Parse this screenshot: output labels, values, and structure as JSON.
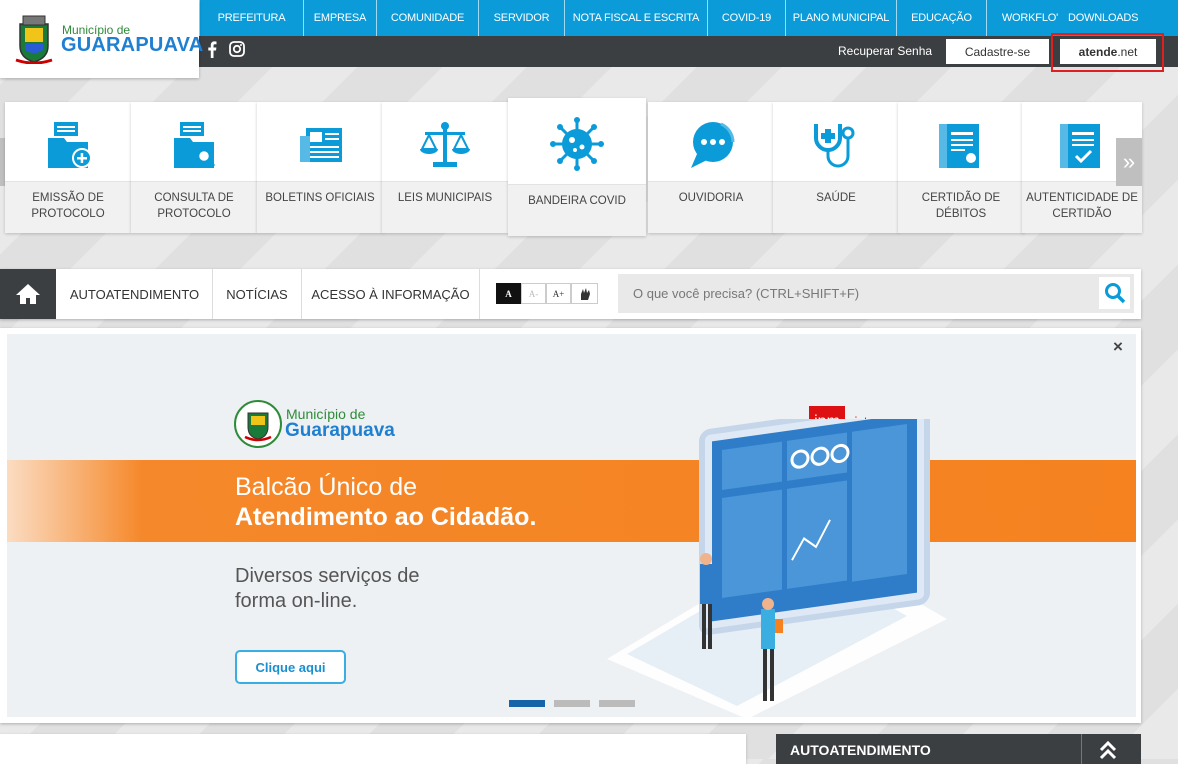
{
  "header": {
    "logo_top": "Município de",
    "logo_bottom": "GUARAPUAVA",
    "top_nav": [
      "PREFEITURA",
      "EMPRESA",
      "COMUNIDADE",
      "SERVIDOR",
      "NOTA FISCAL E ESCRITA",
      "COVID-19",
      "PLANO MUNICIPAL",
      "EDUCAÇÃO",
      "WORKFLO'",
      "DOWNLOADS"
    ],
    "recover_password": "Recuperar Senha",
    "signup": "Cadastre-se",
    "atende_bold": "atende",
    "atende_rest": ".net"
  },
  "services": [
    {
      "label": "EMISSÃO DE PROTOCOLO",
      "icon": "folder-plus-icon"
    },
    {
      "label": "CONSULTA DE PROTOCOLO",
      "icon": "folder-search-icon"
    },
    {
      "label": "BOLETINS OFICIAIS",
      "icon": "newspaper-icon"
    },
    {
      "label": "LEIS MUNICIPAIS",
      "icon": "scales-icon"
    },
    {
      "label": "BANDEIRA COVID",
      "icon": "virus-icon"
    },
    {
      "label": "OUVIDORIA",
      "icon": "chat-bubble-icon"
    },
    {
      "label": "SAÚDE",
      "icon": "stethoscope-icon"
    },
    {
      "label": "CERTIDÃO DE DÉBITOS",
      "icon": "certificate-icon"
    },
    {
      "label": "AUTENTICIDADE DE CERTIDÃO",
      "icon": "certificate-check-icon"
    }
  ],
  "nav": {
    "items": [
      "AUTOATENDIMENTO",
      "NOTÍCIAS",
      "ACESSO À INFORMAÇÃO"
    ],
    "font_buttons": [
      "A",
      "A-",
      "A+"
    ],
    "search_placeholder": "O que você precisa? (CTRL+SHIFT+F)"
  },
  "banner": {
    "logo_top": "Município de",
    "logo_bottom": "Guarapuava",
    "ipm_logo": "ipm",
    "ipm_text": "sistemas",
    "line1": "Balcão Único de",
    "line2": "Atendimento ao Cidadão.",
    "line3": "Diversos serviços de",
    "line4": "forma on-line.",
    "cta": "Clique aqui",
    "close": "×",
    "active_slide": 1,
    "slide_count": 3
  },
  "bottom": {
    "right_title": "AUTOATENDIMENTO"
  },
  "colors": {
    "primary": "#0a9bd8",
    "dark": "#3c3f42",
    "orange": "#f5821f",
    "accent_red": "#e02020"
  }
}
